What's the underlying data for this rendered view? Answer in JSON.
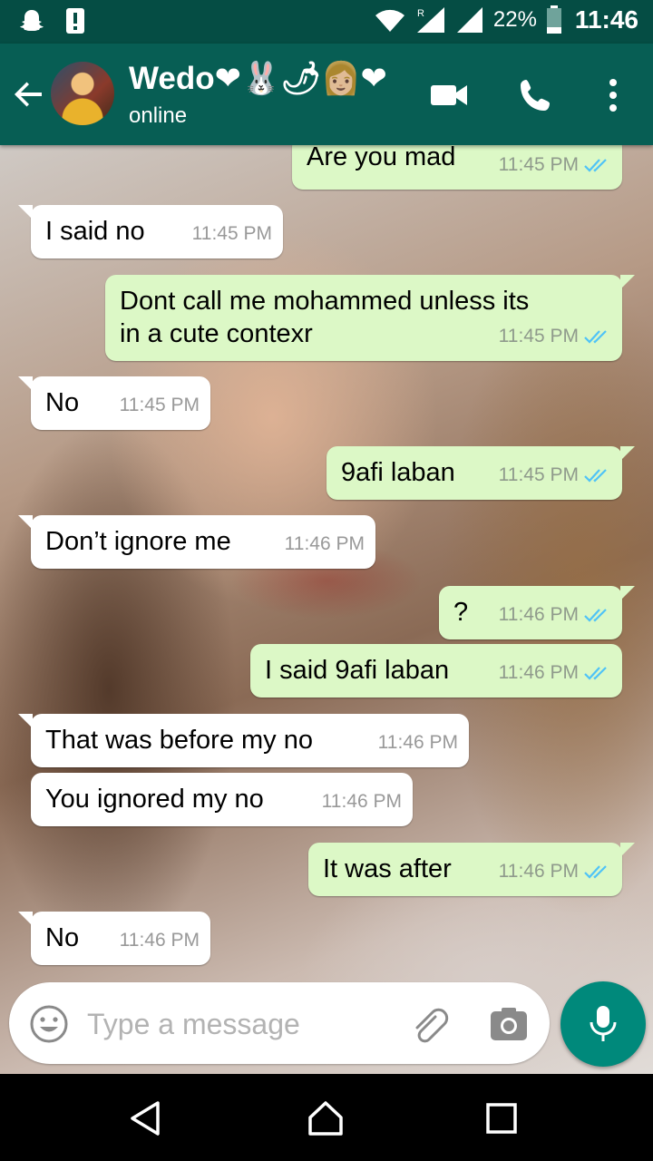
{
  "status_bar": {
    "battery_percent": "22%",
    "time": "11:46"
  },
  "header": {
    "contact_name": "Wedo❤🐰🌶👩🏼❤",
    "contact_status": "online"
  },
  "messages": [
    {
      "direction": "out",
      "text": "Are you mad",
      "time": "11:45 PM",
      "read": true
    },
    {
      "direction": "in",
      "text": "I said no",
      "time": "11:45 PM"
    },
    {
      "direction": "out",
      "text": "Dont call me mohammed unless its",
      "text2": "in a cute contexr",
      "time": "11:45 PM",
      "read": true
    },
    {
      "direction": "in",
      "text": "No",
      "time": "11:45 PM"
    },
    {
      "direction": "out",
      "text": "9afi laban",
      "time": "11:45 PM",
      "read": true
    },
    {
      "direction": "in",
      "text": "Don’t ignore me",
      "time": "11:46 PM"
    },
    {
      "direction": "out",
      "text": "?",
      "time": "11:46 PM",
      "read": true
    },
    {
      "direction": "out",
      "text": "I said 9afi laban",
      "time": "11:46 PM",
      "read": true
    },
    {
      "direction": "in",
      "text": "That was before my no",
      "time": "11:46 PM"
    },
    {
      "direction": "in",
      "text": "You ignored my no",
      "time": "11:46 PM"
    },
    {
      "direction": "out",
      "text": "It was after",
      "time": "11:46 PM",
      "read": true
    },
    {
      "direction": "in",
      "text": "No",
      "time": "11:46 PM"
    }
  ],
  "input": {
    "placeholder": "Type a message",
    "value": ""
  },
  "colors": {
    "header": "#075e54",
    "status_bar": "#054d44",
    "outgoing_bubble": "#dcf8c6",
    "incoming_bubble": "#ffffff",
    "read_ticks": "#4fc3f7",
    "mic_button": "#00897b"
  },
  "icons": {
    "status_left": [
      "snapchat-ghost-icon",
      "alert-icon"
    ],
    "status_right": [
      "wifi-icon",
      "signal-icon",
      "signal-icon-2",
      "battery-icon"
    ],
    "header": [
      "back-arrow-icon",
      "video-call-icon",
      "phone-icon",
      "more-vert-icon"
    ],
    "input": [
      "emoji-icon",
      "attach-icon",
      "camera-icon",
      "mic-icon"
    ],
    "nav": [
      "nav-back-icon",
      "nav-home-icon",
      "nav-recent-icon"
    ]
  }
}
